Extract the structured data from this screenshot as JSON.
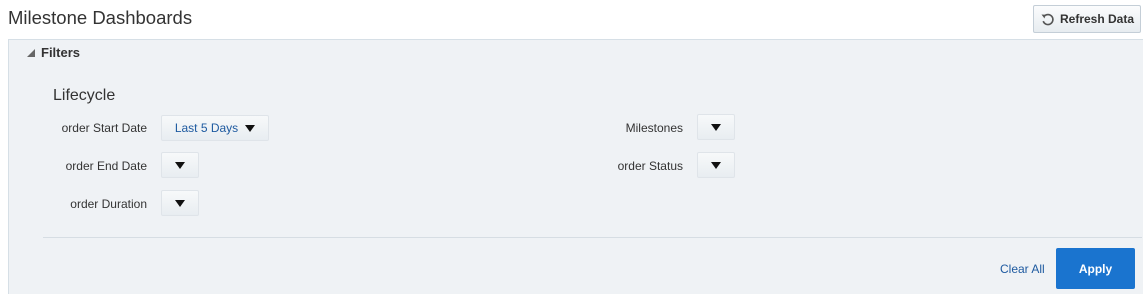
{
  "page": {
    "title": "Milestone Dashboards"
  },
  "toolbar": {
    "refresh_label": "Refresh Data",
    "refresh_icon": "refresh-icon"
  },
  "filters": {
    "header": "Filters",
    "section_title": "Lifecycle",
    "fields": {
      "order_start_date": {
        "label": "order Start Date",
        "value": "Last 5 Days"
      },
      "order_end_date": {
        "label": "order End Date",
        "value": ""
      },
      "order_duration": {
        "label": "order Duration",
        "value": ""
      },
      "milestones": {
        "label": "Milestones",
        "value": ""
      },
      "order_status": {
        "label": "order Status",
        "value": ""
      }
    },
    "clear_all_label": "Clear All",
    "apply_label": "Apply"
  },
  "colors": {
    "accent": "#1a74cf",
    "link": "#1e5aa0",
    "panel_bg": "#eff2f5"
  }
}
